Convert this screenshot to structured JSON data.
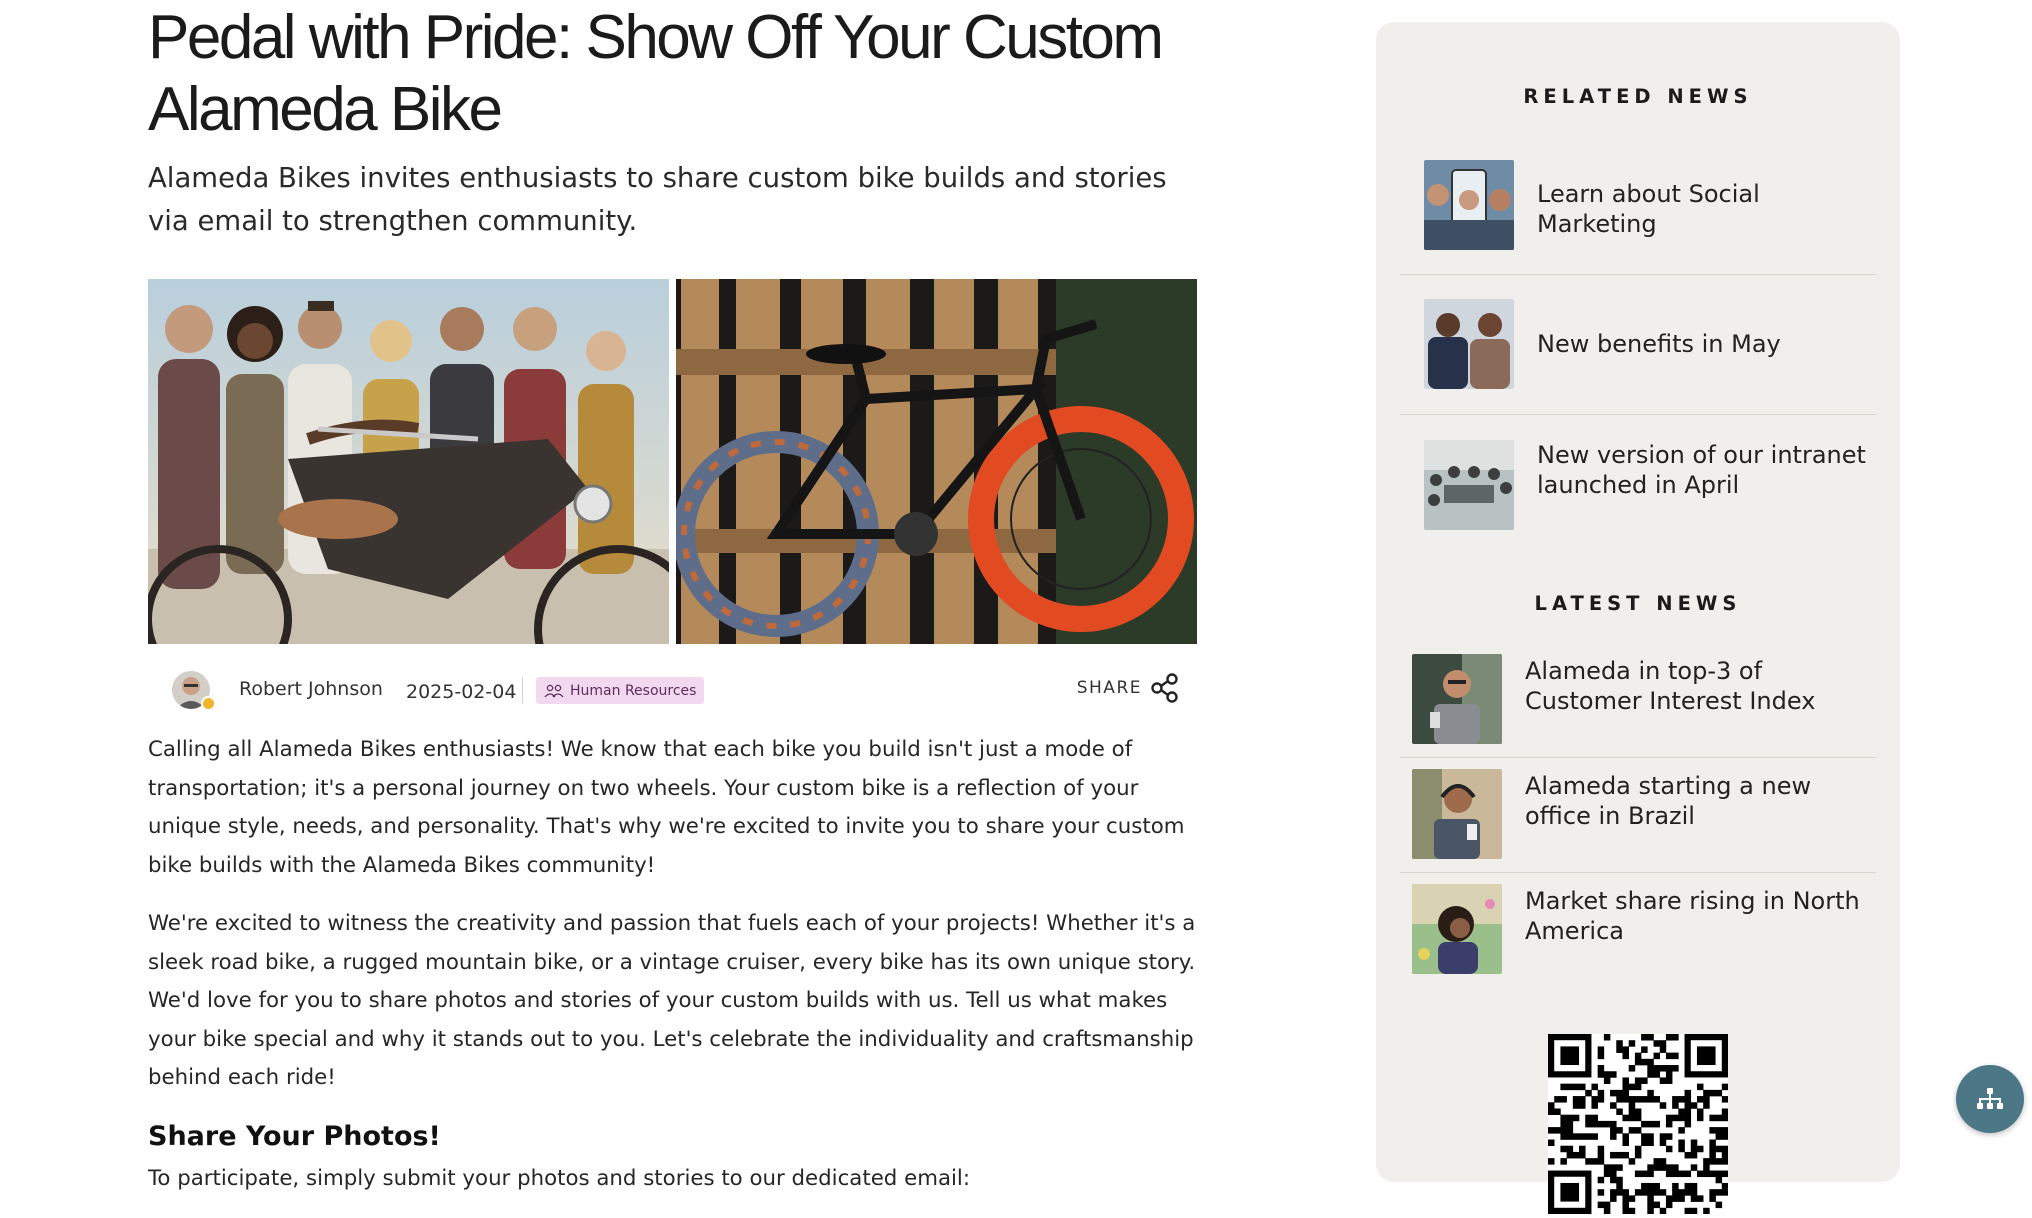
{
  "article": {
    "title": "Pedal with Pride: Show Off Your Custom Alameda Bike",
    "subtitle": "Alameda Bikes invites enthusiasts to share custom bike builds and stories via email to strengthen community.",
    "author": "Robert Johnson",
    "date": "2025-02-04",
    "tag": "Human Resources",
    "share_label": "SHARE",
    "paragraphs": [
      "Calling all Alameda Bikes enthusiasts! We know that each bike you build isn't just a mode of transportation; it's a personal journey on two wheels. Your custom bike is a reflection of your unique style, needs, and personality. That's why we're excited to invite you to share your custom bike builds with the Alameda Bikes community!",
      "We're excited to witness the creativity and passion that fuels each of your projects! Whether it's a sleek road bike, a rugged mountain bike, or a vintage cruiser, every bike has its own unique story. We'd love for you to share photos and stories of your custom builds with us. Tell us what makes your bike special and why it stands out to you. Let's celebrate the individuality and craftsmanship behind each ride!"
    ],
    "section_heading": "Share Your Photos!",
    "section_text": "To participate, simply submit your photos and stories to our dedicated email:"
  },
  "sidebar": {
    "related_heading": "RELATED NEWS",
    "related": [
      {
        "label": "Learn about Social Marketing"
      },
      {
        "label": "New benefits in May"
      },
      {
        "label": "New version of our intranet launched in April"
      }
    ],
    "latest_heading": "LATEST NEWS",
    "latest": [
      {
        "label": "Alameda in top-3 of Customer Interest Index"
      },
      {
        "label": "Alameda starting a new office in Brazil"
      },
      {
        "label": "Market share rising in North America"
      }
    ]
  },
  "icons": {
    "share": "share-icon",
    "tag": "people-icon",
    "fab": "sitemap-icon"
  },
  "colors": {
    "tag_bg": "#f2d9f0",
    "sidebar_bg": "#f1efeb",
    "fab_bg": "#4c7787",
    "presence": "#f0b52a"
  }
}
